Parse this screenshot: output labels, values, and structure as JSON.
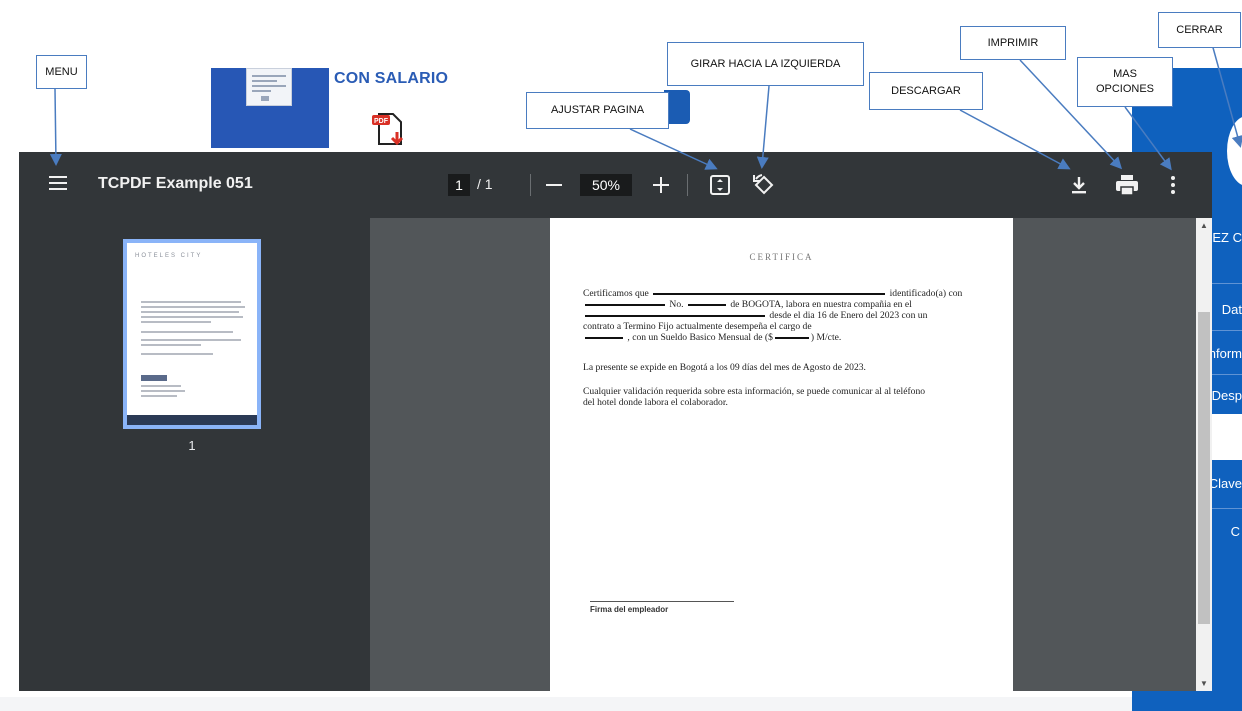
{
  "background": {
    "card_title": "CON SALARIO",
    "pdf_icon_label": "PDF",
    "right_panel_fragments": [
      "REZ C",
      "Dat",
      "Inform",
      "Desp",
      "Clave",
      "C"
    ]
  },
  "viewer": {
    "title": "TCPDF Example 051",
    "current_page": "1",
    "page_separator": "/",
    "total_pages": "1",
    "zoom": "50%",
    "thumbnail_page_number": "1",
    "thumbnail_header": "HOTELES CITY"
  },
  "document": {
    "heading": "CERTIFICA",
    "p1_start": "Certificamos que",
    "p1_identified": "identificado(a) con",
    "p1_no": "No.",
    "p1_city": "de BOGOTA, labora en nuestra compañia en el",
    "p1_since": "desde el dia 16 de Enero del 2023 con un",
    "p1_contract": "contrato a Termino Fijo actualmente desempeña el cargo de",
    "p1_salary": ", con un Sueldo Basico Mensual de ($",
    "p1_salary_end": ") M/cte.",
    "p2": "La presente se expide en Bogotá a los 09 días del mes de Agosto de 2023.",
    "p3_line1": "Cualquier validación requerida sobre esta información, se puede comunicar al al teléfono",
    "p3_line2": "del hotel donde labora el colaborador.",
    "signature_label": "Firma del empleador"
  },
  "callouts": {
    "menu": "MENU",
    "ajustar": "AJUSTAR PAGINA",
    "girar": "GIRAR HACIA LA IZQUIERDA",
    "descargar": "DESCARGAR",
    "imprimir": "IMPRIMIR",
    "mas_line1": "MAS",
    "mas_line2": "OPCIONES",
    "cerrar": "CERRAR"
  },
  "icons": {
    "menu": "hamburger-menu-icon",
    "zoom_out": "minus-icon",
    "zoom_in": "plus-icon",
    "fit": "fit-to-page-icon",
    "rotate": "rotate-counterclockwise-icon",
    "download": "download-icon",
    "print": "printer-icon",
    "more": "more-vertical-icon"
  },
  "colors": {
    "toolbar": "#323639",
    "viewer_bg": "#525659",
    "thumb_highlight": "#8ab4f8",
    "callout_border": "#4a7cc0",
    "site_blue": "#0f61be"
  }
}
